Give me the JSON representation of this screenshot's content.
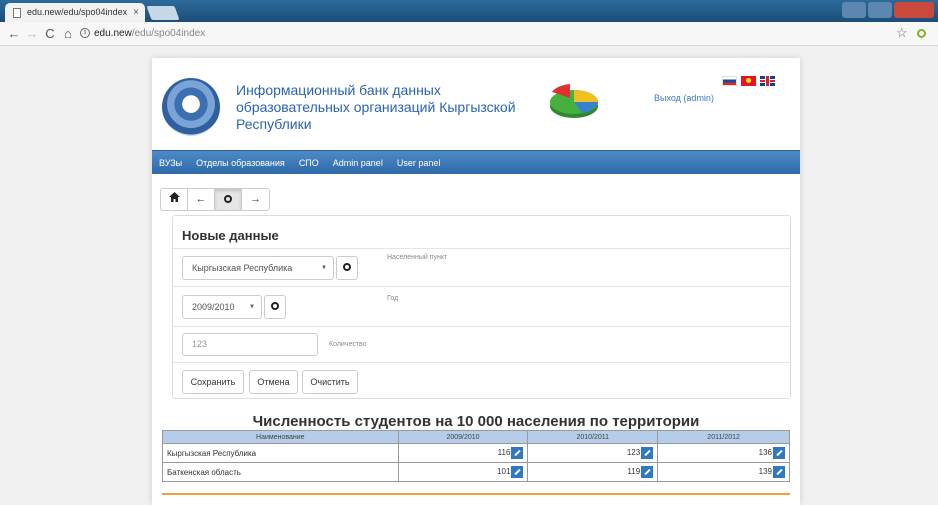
{
  "browser": {
    "tab_title": "edu.new/edu/spo04index",
    "close_tab": "×",
    "url_host": "edu.new",
    "url_path": "/edu/spo04index",
    "info_glyph": "i",
    "back": "←",
    "forward": "→",
    "reload": "C",
    "home": "⌂",
    "star": "☆"
  },
  "header": {
    "title": "Информационный банк данных образовательных организаций Кыргызской Республики",
    "logout": "Выход (admin)"
  },
  "nav": {
    "items": [
      "ВУЗы",
      "Отделы образования",
      "СПО",
      "Admin panel",
      "User panel"
    ]
  },
  "toolbar": {
    "home": "🏠",
    "back": "←",
    "forward": "→"
  },
  "form": {
    "title": "Новые данные",
    "region_value": "Кыргызская Республика",
    "region_label": "Населенный пункт",
    "year_value": "2009/2010",
    "year_label": "Год",
    "count_placeholder": "123",
    "count_label": "Количество",
    "save": "Сохранить",
    "cancel": "Отмена",
    "clear": "Очистить"
  },
  "table": {
    "title": "Численность студентов на 10 000 населения по территории",
    "headers": [
      "Наименование",
      "2009/2010",
      "2010/2011",
      "2011/2012"
    ],
    "rows": [
      [
        "Кыргызская Республика",
        "116",
        "123",
        "136"
      ],
      [
        "Баткенская область",
        "101",
        "119",
        "139"
      ]
    ]
  },
  "colors": {
    "navbar": "#3777b5",
    "table_header": "#b5cde8",
    "accent_line": "#f0a040",
    "title_blue": "#2c63b0"
  }
}
